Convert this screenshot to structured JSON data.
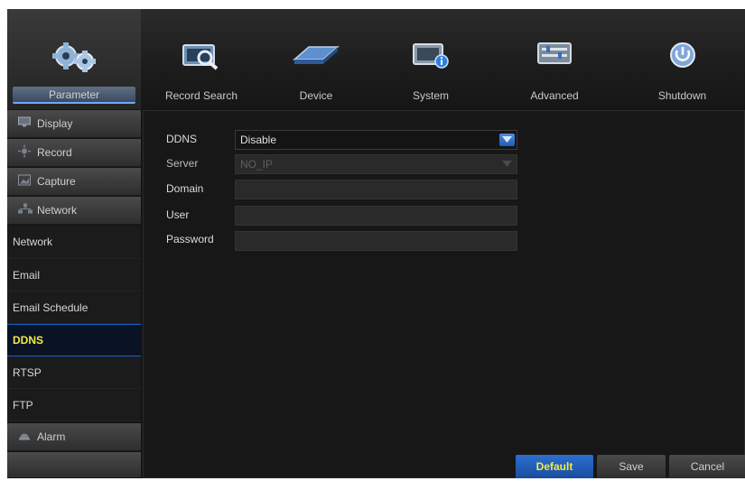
{
  "nav": {
    "tabs": [
      {
        "label": "Parameter",
        "icon": "gears-icon"
      },
      {
        "label": "Record Search",
        "icon": "search-icon"
      },
      {
        "label": "Device",
        "icon": "hard-drive-icon"
      },
      {
        "label": "System",
        "icon": "system-info-icon"
      },
      {
        "label": "Advanced",
        "icon": "advanced-settings-icon"
      },
      {
        "label": "Shutdown",
        "icon": "power-icon"
      }
    ],
    "active_tab": "Parameter"
  },
  "sidebar": {
    "categories": {
      "display": "Display",
      "record": "Record",
      "capture": "Capture",
      "network": "Network",
      "alarm": "Alarm"
    },
    "network_items": [
      "Network",
      "Email",
      "Email Schedule",
      "DDNS",
      "RTSP",
      "FTP"
    ],
    "selected": "DDNS"
  },
  "form": {
    "ddns_label": "DDNS",
    "ddns_value": "Disable",
    "server_label": "Server",
    "server_value": "NO_IP",
    "domain_label": "Domain",
    "domain_value": "",
    "user_label": "User",
    "user_value": "",
    "password_label": "Password",
    "password_value": ""
  },
  "buttons": {
    "default": "Default",
    "save": "Save",
    "cancel": "Cancel"
  },
  "colors": {
    "accent_blue": "#1f5bb5",
    "highlight_yellow": "#f2e94a",
    "background": "#151515"
  }
}
